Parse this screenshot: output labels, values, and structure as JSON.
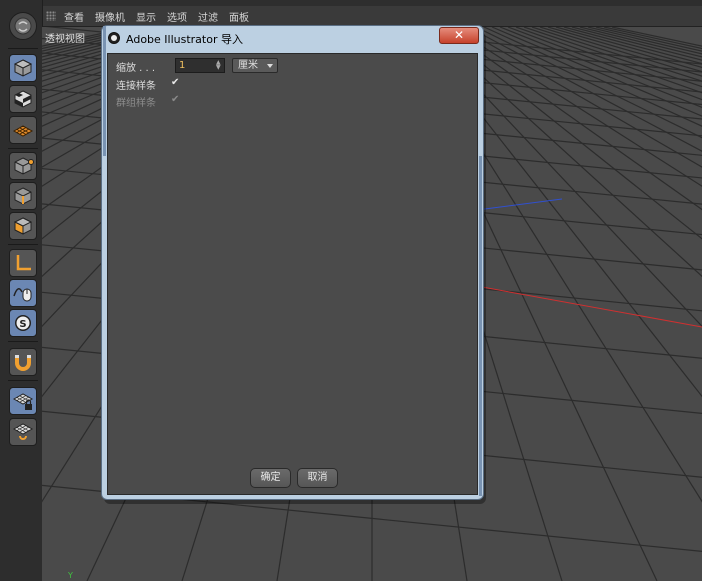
{
  "menu": {
    "items": [
      "查看",
      "摄像机",
      "显示",
      "选项",
      "过滤",
      "面板"
    ]
  },
  "viewport": {
    "label": "透视视图",
    "axis_label": "Y"
  },
  "dialog": {
    "title": "Adobe Illustrator 导入",
    "close_glyph": "✕",
    "scale_label": "缩放 . . .",
    "scale_value": "1",
    "unit_value": "厘米",
    "connect_splines_label": "连接样条",
    "connect_splines_check": "✔",
    "group_splines_label": "群组样条",
    "group_splines_check": "✔",
    "ok_label": "确定",
    "cancel_label": "取消"
  },
  "toolbar_icons": [
    "cube-icon",
    "checker-cube-icon",
    "grid-plane-icon",
    "points-cube-icon",
    "edges-cube-icon",
    "polygons-cube-icon",
    "axis-icon",
    "mouse-tweak-icon",
    "snap-icon",
    "magnet-icon",
    "locked-workplane-icon",
    "workplane-rotate-icon"
  ],
  "colors": {
    "accent": "#6b87b3",
    "close": "#c6412b",
    "dialog_frame": "#bcd0e2",
    "dialog_body": "#4b4b4b",
    "axis_x": "#d03030",
    "axis_z": "#3050d0"
  }
}
